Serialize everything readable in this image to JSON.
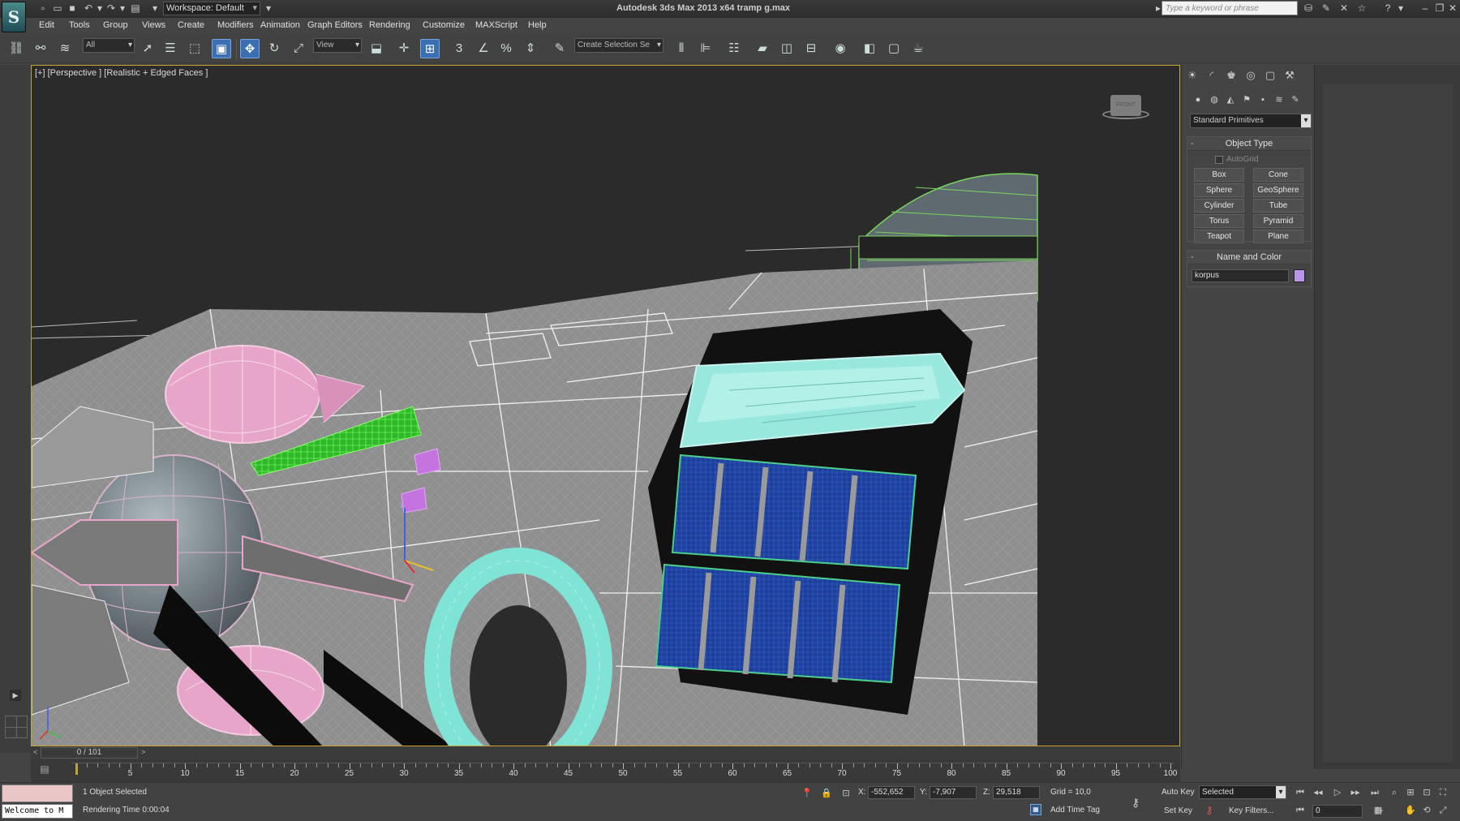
{
  "titlebar": {
    "workspace": "Workspace: Default",
    "title": "Autodesk 3ds Max  2013 x64     tramp g.max",
    "search_placeholder": "Type a keyword or phrase"
  },
  "menu": [
    "Edit",
    "Tools",
    "Group",
    "Views",
    "Create",
    "Modifiers",
    "Animation",
    "Graph Editors",
    "Rendering",
    "Customize",
    "MAXScript",
    "Help"
  ],
  "toolbar": {
    "selection_filter": "All",
    "ref_coord": "View",
    "named_selection": "Create Selection Se",
    "snap_3": "3",
    "percent_snap": "%"
  },
  "viewport": {
    "label": "[+] [Perspective ] [Realistic + Edged Faces ]",
    "viewcube_text": "FRONT",
    "colors": {
      "background": "#2b2b2b",
      "hull": "#8f8f8f",
      "selection_border": "#c7a431",
      "pink_wire": "#e7a6c9",
      "green_panel": "#3fcf2f",
      "cyan_part": "#7fe3d6",
      "blue_solar": "#1d3f9c",
      "purple_part": "#c574df"
    }
  },
  "command_panel": {
    "tabs": [
      "create-icon",
      "modify-icon",
      "hierarchy-icon",
      "motion-icon",
      "display-icon",
      "utilities-icon"
    ],
    "subtabs": [
      "geometry-icon",
      "shapes-icon",
      "lights-icon",
      "cameras-icon",
      "helpers-icon",
      "spacewarps-icon",
      "systems-icon"
    ],
    "category": "Standard Primitives",
    "object_type": {
      "header": "Object Type",
      "autogrid_label": "AutoGrid",
      "autogrid_checked": false,
      "buttons": [
        "Box",
        "Cone",
        "Sphere",
        "GeoSphere",
        "Cylinder",
        "Tube",
        "Torus",
        "Pyramid",
        "Teapot",
        "Plane"
      ]
    },
    "name_and_color": {
      "header": "Name and Color",
      "name": "korpus",
      "color": "#b996e6"
    }
  },
  "timeline": {
    "slider_text": "0 / 101",
    "current_frame": 0,
    "total_frames": 101,
    "tick_labels": [
      "5",
      "10",
      "15",
      "20",
      "25",
      "30",
      "35",
      "40",
      "45",
      "50",
      "55",
      "60",
      "65",
      "70",
      "75",
      "80",
      "85",
      "90",
      "95",
      "100"
    ]
  },
  "status": {
    "welcome": "Welcome to M",
    "selection_info": "1 Object Selected",
    "render_time": "Rendering Time  0:00:04",
    "x_label": "X:",
    "x_value": "-552,652",
    "y_label": "Y:",
    "y_value": "-7,907",
    "z_label": "Z:",
    "z_value": "29,518",
    "grid": "Grid = 10,0",
    "add_time_tag": "Add Time Tag",
    "auto_key": "Auto Key",
    "set_key": "Set Key",
    "key_mode": "Selected",
    "key_filters": "Key Filters...",
    "frame": "0"
  }
}
